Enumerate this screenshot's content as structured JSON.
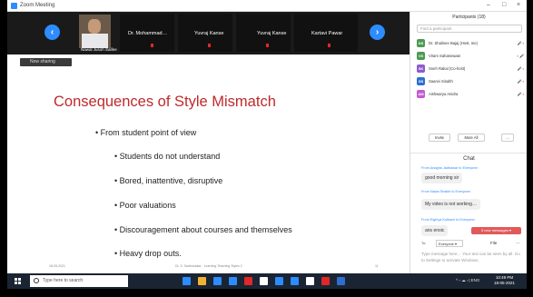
{
  "window": {
    "title": "Zoom Meeting",
    "controls": [
      "–",
      "□",
      "×"
    ]
  },
  "video_strip": {
    "prev_label": "‹",
    "next_label": "›",
    "self_label": "Nawal Jusoh Saifee",
    "tiles": [
      "Dr. Mohammad…",
      "Yuvraj Kanse",
      "Yuvraj Kanse",
      "Kartavi Pawar"
    ]
  },
  "view_badge": "Now sharing",
  "slide": {
    "title": "Consequences of Style Mismatch",
    "bullet_main": "From student point of view",
    "bullets": [
      "Students do not understand",
      "Bored, inattentive, disruptive",
      "Poor valuations",
      "Discouragement about courses and themselves",
      "Heavy drop outs."
    ],
    "footer_left": "18-05-2021",
    "footer_center": "Dr. S. Sadhanakar · Learning Teaching Styles 2",
    "footer_right": "11"
  },
  "participants": {
    "header": "Participants (18)",
    "search_placeholder": "Find a participant",
    "list": [
      {
        "initials": "DS",
        "name": "Dr. Shalinee Bajaj (Host, me)",
        "status": "🎤 ▪",
        "color": "#4c9a52"
      },
      {
        "initials": "VS",
        "name": "Viram Sahasrawan",
        "status": "▪ 🎤",
        "color": "#4c9a52"
      },
      {
        "initials": "SK",
        "name": "Sneh Rakal (Co-host)",
        "status": "🎤 ▪",
        "color": "#8e5ad0"
      },
      {
        "initials": "SS",
        "name": "Saanvi Sinalth",
        "status": "🎤 ▪",
        "color": "#2d6fd0"
      },
      {
        "initials": "AM",
        "name": "Aishwarya Anidra",
        "status": "🎤 ▪",
        "color": "#c45ad0"
      }
    ],
    "invite_label": "Invite",
    "mute_all_label": "Mute All",
    "more_label": "…"
  },
  "chat": {
    "header": "Chat",
    "messages": [
      {
        "meta": "From Anagha Jadhawar to Everyone:",
        "text": "good morning sir"
      },
      {
        "meta": "From Nazia Shaikh to Everyone:",
        "text": "My video is not working…"
      },
      {
        "meta": "From Eigiriya Kulkarni to Everyone:",
        "text": "ans enoic"
      }
    ],
    "new_message_notice": "3 new messages ▾",
    "to_label": "To:",
    "to_value": "Everyone ▾",
    "file_label": "File",
    "more_label": "…",
    "input_placeholder": "Type message here… Your text can be seen by all. Go to Settings to activate Windows."
  },
  "taskbar": {
    "search_placeholder": "Type here to search",
    "tray_text": "^ ▫ ☁ ◁ ENG",
    "time": "10:49 PM",
    "date": "18-05-2021",
    "app_colors": [
      "#2d8cff",
      "#f2b233",
      "#2d8cff",
      "#2d8cff",
      "#e02828",
      "#ffffff",
      "#2d8cff",
      "#2d8cff",
      "#ffffff",
      "#e02828",
      "#2d6fd0"
    ]
  }
}
